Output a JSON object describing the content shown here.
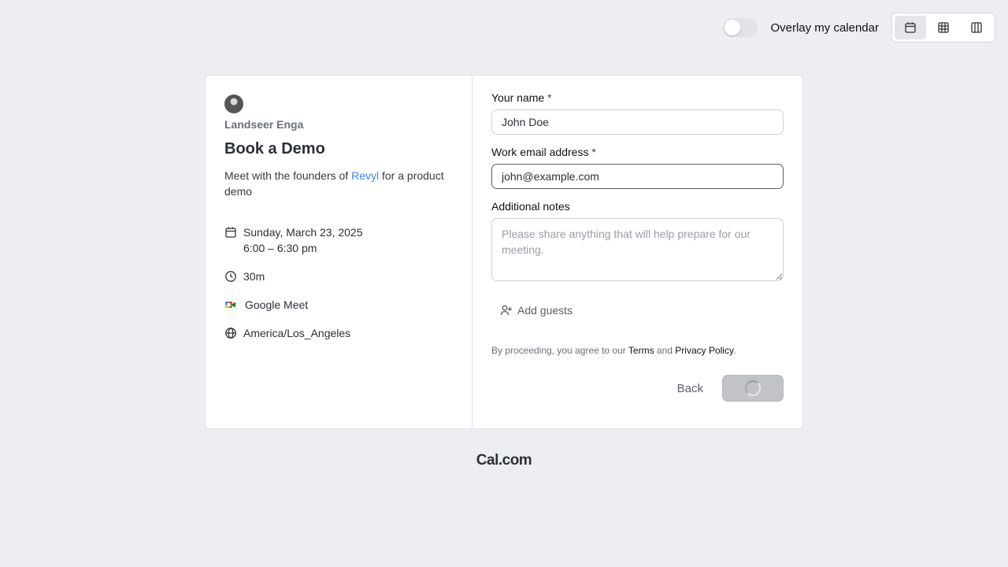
{
  "topbar": {
    "overlay_label": "Overlay my calendar",
    "overlay_enabled": false,
    "views": [
      {
        "icon": "calendar-icon",
        "active": true
      },
      {
        "icon": "grid-icon",
        "active": false
      },
      {
        "icon": "columns-icon",
        "active": false
      }
    ]
  },
  "event": {
    "host_name": "Landseer Enga",
    "title": "Book a Demo",
    "description_before": "Meet with the founders of ",
    "description_link": "Revyl",
    "description_after": " for a product demo",
    "date": "Sunday, March 23, 2025",
    "time": "6:00 – 6:30 pm",
    "duration": "30m",
    "location": "Google Meet",
    "timezone": "America/Los_Angeles"
  },
  "form": {
    "name_label": "Your name",
    "name_required": "*",
    "name_value": "John Doe",
    "email_label": "Work email address",
    "email_required": "*",
    "email_value": "john@example.com",
    "notes_label": "Additional notes",
    "notes_placeholder": "Please share anything that will help prepare for our meeting.",
    "add_guests_label": "Add guests",
    "terms_before": "By proceeding, you agree to our ",
    "terms_link": "Terms",
    "terms_and": " and ",
    "privacy_link": "Privacy Policy",
    "terms_end": ".",
    "back_label": "Back"
  },
  "brand": "Cal.com"
}
